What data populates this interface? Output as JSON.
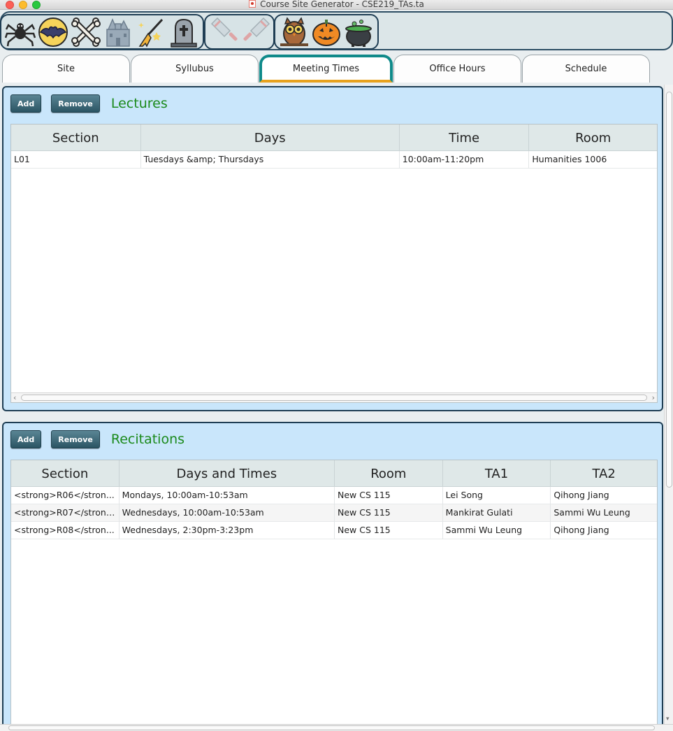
{
  "window": {
    "title": "Course Site Generator - CSE219_TAs.ta"
  },
  "toolbar": {
    "groups": [
      {
        "icons": [
          "spider-icon",
          "bat-icon",
          "crossbones-icon",
          "haunted-house-icon",
          "witch-broom-icon",
          "tombstone-icon"
        ]
      },
      {
        "icons": [
          "cleaver-icon",
          "cleaver-icon"
        ]
      },
      {
        "icons": [
          "owl-icon",
          "jack-o-lantern-icon",
          "cauldron-icon"
        ]
      }
    ]
  },
  "tabs": [
    {
      "label": "Site",
      "active": false
    },
    {
      "label": "Syllubus",
      "active": false
    },
    {
      "label": "Meeting Times",
      "active": true
    },
    {
      "label": "Office Hours",
      "active": false
    },
    {
      "label": "Schedule",
      "active": false
    }
  ],
  "lectures": {
    "title": "Lectures",
    "add_label": "Add",
    "remove_label": "Remove",
    "columns": [
      "Section",
      "Days",
      "Time",
      "Room"
    ],
    "rows": [
      [
        "L01",
        "Tuesdays &amp; Thursdays",
        "10:00am-11:20pm",
        "Humanities 1006"
      ]
    ]
  },
  "recitations": {
    "title": "Recitations",
    "add_label": "Add",
    "remove_label": "Remove",
    "columns": [
      "Section",
      "Days and Times",
      "Room",
      "TA1",
      "TA2"
    ],
    "rows": [
      [
        "<strong>R06</stron...",
        "Mondays, 10:00am-10:53am",
        "New CS 115",
        "Lei Song",
        "Qihong Jiang"
      ],
      [
        "<strong>R07</strong...",
        "Wednesdays, 10:00am-10:53am",
        "New CS 115",
        "Mankirat Gulati",
        "Sammi Wu Leung"
      ],
      [
        "<strong>R08</stron...",
        "Wednesdays, 2:30pm-3:23pm",
        "New CS 115",
        "Sammi Wu Leung",
        "Qihong Jiang"
      ]
    ]
  },
  "colors": {
    "accent_teal": "#0f8a8a",
    "accent_orange": "#e8a21d",
    "pane_bg": "#c9e6fb",
    "title_green": "#1b8a1b"
  }
}
